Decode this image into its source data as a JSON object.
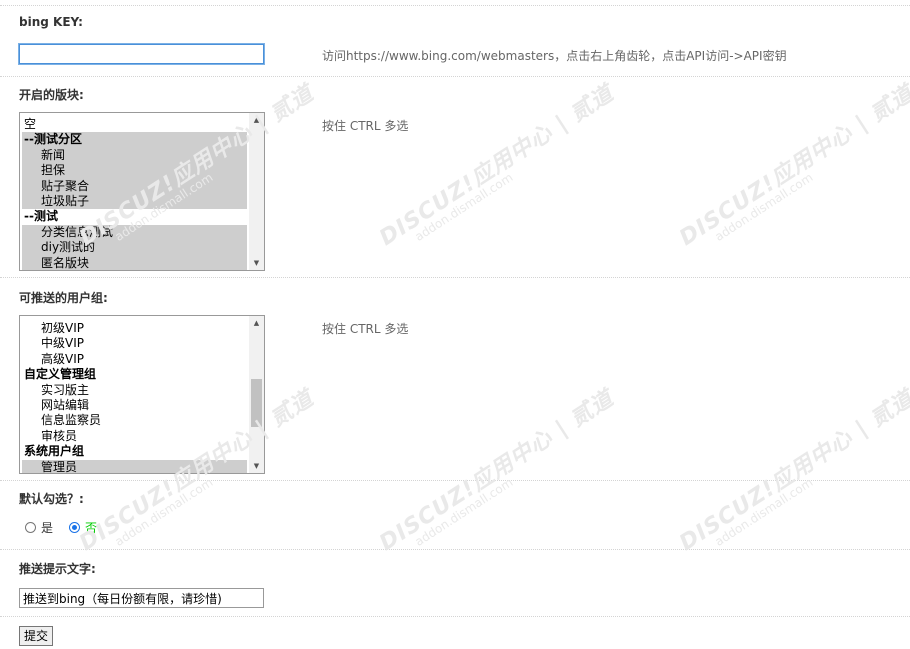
{
  "bing_key": {
    "label": "bing KEY:",
    "value": "",
    "hint": "访问https://www.bing.com/webmasters，点击右上角齿轮，点击API访问->API密钥"
  },
  "forums": {
    "label": "开启的版块:",
    "hint": "按住 CTRL 多选",
    "options": [
      {
        "text": "空",
        "group": false,
        "indent": false,
        "selected": false
      },
      {
        "text": "--测试分区",
        "group": true,
        "indent": false,
        "selected": true
      },
      {
        "text": "新闻",
        "group": false,
        "indent": true,
        "selected": true
      },
      {
        "text": "担保",
        "group": false,
        "indent": true,
        "selected": true
      },
      {
        "text": "贴子聚合",
        "group": false,
        "indent": true,
        "selected": true
      },
      {
        "text": "垃圾贴子",
        "group": false,
        "indent": true,
        "selected": true
      },
      {
        "text": "--测试",
        "group": true,
        "indent": false,
        "selected": false
      },
      {
        "text": "分类信息测试",
        "group": false,
        "indent": true,
        "selected": true
      },
      {
        "text": "diy测试的",
        "group": false,
        "indent": true,
        "selected": true
      },
      {
        "text": "匿名版块",
        "group": false,
        "indent": true,
        "selected": true
      }
    ]
  },
  "usergroups": {
    "label": "可推送的用户组:",
    "hint": "按住 CTRL 多选",
    "options": [
      {
        "text": "初级VIP",
        "group": false,
        "indent": true,
        "selected": false
      },
      {
        "text": "中级VIP",
        "group": false,
        "indent": true,
        "selected": false
      },
      {
        "text": "高级VIP",
        "group": false,
        "indent": true,
        "selected": false
      },
      {
        "text": "自定义管理组",
        "group": true,
        "indent": false,
        "selected": false
      },
      {
        "text": "实习版主",
        "group": false,
        "indent": true,
        "selected": false
      },
      {
        "text": "网站编辑",
        "group": false,
        "indent": true,
        "selected": false
      },
      {
        "text": "信息监察员",
        "group": false,
        "indent": true,
        "selected": false
      },
      {
        "text": "审核员",
        "group": false,
        "indent": true,
        "selected": false
      },
      {
        "text": "系统用户组",
        "group": true,
        "indent": false,
        "selected": false
      },
      {
        "text": "管理员",
        "group": false,
        "indent": true,
        "selected": true
      }
    ]
  },
  "default_checked": {
    "label": "默认勾选？:",
    "yes_label": "是",
    "no_label": "否",
    "selected": "no",
    "no_label_color": "#00cc00"
  },
  "prompt_text": {
    "label": "推送提示文字:",
    "value": "推送到bing（每日份额有限，请珍惜)"
  },
  "submit_label": "提交",
  "watermark": {
    "brand": "DISCUZ!应用中心 | 贰道",
    "domain": "addon.dismall.com"
  }
}
